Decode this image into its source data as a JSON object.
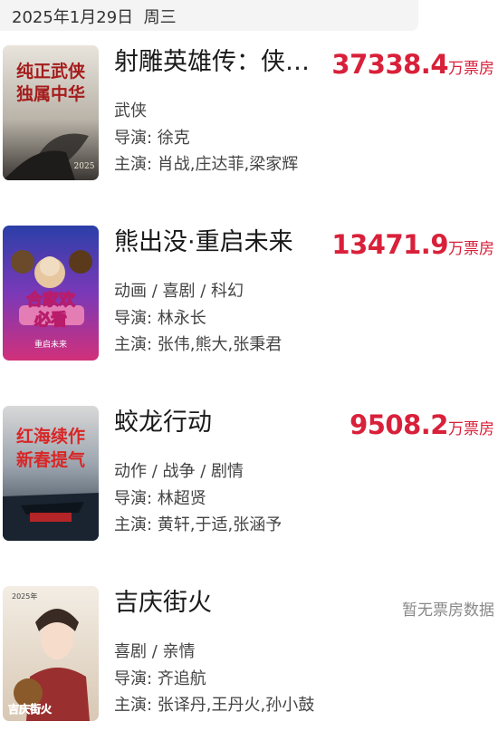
{
  "header": {
    "date": "2025年1月29日",
    "weekday": "周三"
  },
  "movies": [
    {
      "title": "射雕英雄传：侠…",
      "box_value": "37338.4",
      "box_unit": "万票房",
      "genre": "武侠",
      "director": "导演: 徐克",
      "cast": "主演: 肖战,庄达菲,梁家辉",
      "poster_text": [
        "纯正武侠",
        "独属中华",
        "2025"
      ]
    },
    {
      "title": "熊出没·重启未来",
      "box_value": "13471.9",
      "box_unit": "万票房",
      "genre": "动画 / 喜剧 / 科幻",
      "director": "导演: 林永长",
      "cast": "主演: 张伟,熊大,张秉君",
      "poster_text": [
        "合家欢",
        "必看",
        "重启未来"
      ]
    },
    {
      "title": "蛟龙行动",
      "box_value": "9508.2",
      "box_unit": "万票房",
      "genre": "动作 / 战争 / 剧情",
      "director": "导演: 林超贤",
      "cast": "主演: 黄轩,于适,张涵予",
      "poster_text": [
        "红海续作",
        "新春提气"
      ]
    },
    {
      "title": "吉庆街火",
      "no_box": "暂无票房数据",
      "genre": "喜剧 / 亲情",
      "director": "导演: 齐追航",
      "cast": "主演: 张译丹,王丹火,孙小鼓",
      "poster_text": [
        "2025年",
        "吉庆街火"
      ]
    }
  ],
  "colors": {
    "accent": "#d9203a",
    "muted": "#888888"
  }
}
